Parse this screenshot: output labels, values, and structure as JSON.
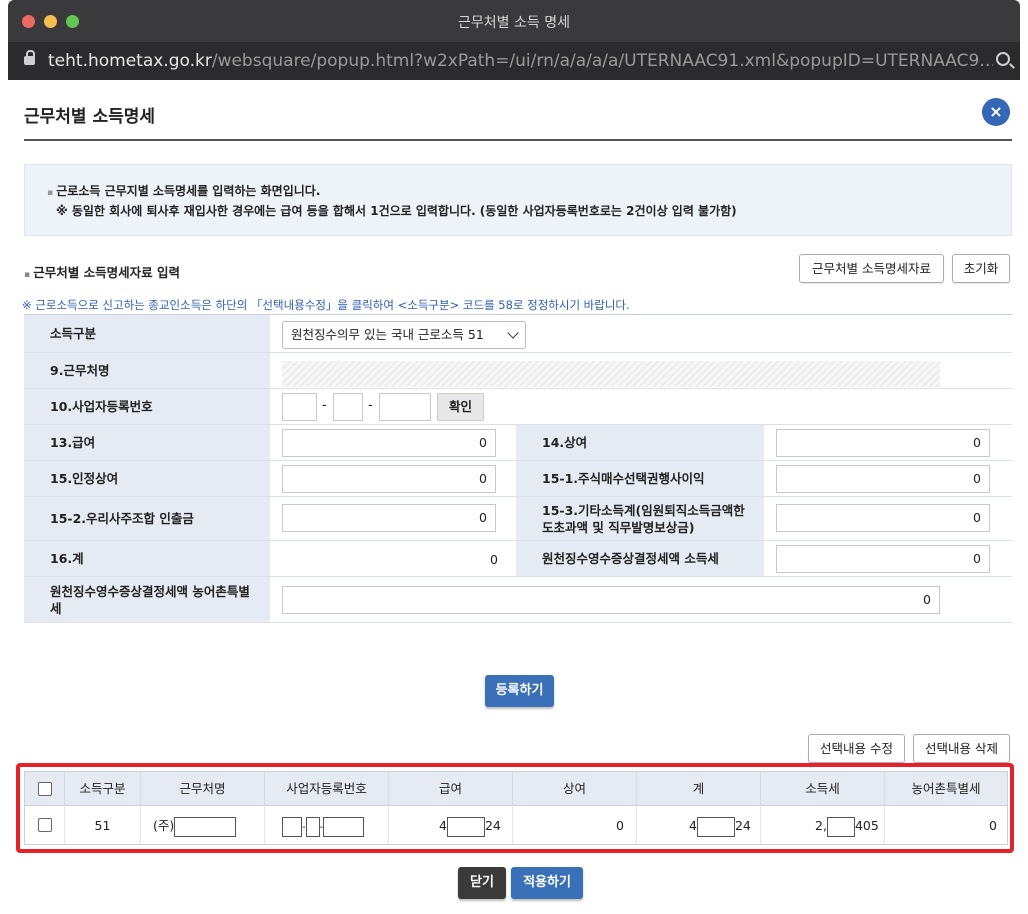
{
  "window": {
    "title": "근무처별 소득 명세"
  },
  "urlbar": {
    "domain": "teht.hometax.go.kr",
    "path": "/websquare/popup.html?w2xPath=/ui/rn/a/a/a/a/UTERNAAC91.xml&popupID=UTERNAAC9…"
  },
  "header": {
    "title": "근무처별 소득명세",
    "close_icon": "×"
  },
  "info": {
    "line1": "근로소득 근무지별 소득명세를 입력하는 화면입니다.",
    "line2": "※ 동일한 회사에 퇴사후 재입사한 경우에는 급여 등을 합해서 1건으로 입력합니다. (동일한 사업자등록번호로는 2건이상 입력 불가함)"
  },
  "section": {
    "title": "근무처별 소득명세자료 입력",
    "data_button": "근무처별 소득명세자료",
    "reset_button": "초기화",
    "notice": "※ 근로소득으로 신고하는 종교인소득은 하단의 「선택내용수정」을 클릭하여 <소득구분> 코드를 58로 정정하시기 바랍니다."
  },
  "form": {
    "income_type_label": "소득구분",
    "income_type_value": "원천징수의무 있는 국내 근로소득 51",
    "workplace_label": "9.근무처명",
    "bizno_label": "10.사업자등록번호",
    "bizno_sep": "-",
    "confirm_button": "확인",
    "salary_label": "13.급여",
    "salary_value": "0",
    "bonus_label": "14.상여",
    "bonus_value": "0",
    "deemed_bonus_label": "15.인정상여",
    "deemed_bonus_value": "0",
    "stock_option_label": "15-1.주식매수선택권행사이익",
    "stock_option_value": "0",
    "esop_label": "15-2.우리사주조합 인출금",
    "esop_value": "0",
    "other_income_label_1": "15-3.기타소득계(임원퇴직소득금액한",
    "other_income_label_2": "도초과액 및 직무발명보상금)",
    "other_income_value": "0",
    "total_label": "16.계",
    "total_value": "0",
    "income_tax_label": "원천징수영수증상결정세액 소득세",
    "income_tax_value": "0",
    "rural_tax_label_1": "원천징수영수증상결정세액 농어촌특별",
    "rural_tax_label_2": "세",
    "rural_tax_value": "0"
  },
  "actions": {
    "register": "등록하기",
    "edit_selected": "선택내용 수정",
    "delete_selected": "선택내용 삭제",
    "close": "닫기",
    "apply": "적용하기"
  },
  "grid": {
    "headers": [
      "소득구분",
      "근무처명",
      "사업자등록번호",
      "급여",
      "상여",
      "계",
      "소득세",
      "농어촌특별세"
    ],
    "row": {
      "type": "51",
      "name_prefix": "(주)",
      "salary_a": "4",
      "salary_b": "24",
      "bonus": "0",
      "total_a": "4",
      "total_b": "24",
      "tax_a": "2,",
      "tax_b": "405",
      "rural": "0"
    }
  },
  "colors": {
    "accent": "#3a70b8",
    "highlight": "#e8202a",
    "label_bg": "#e6eaf3"
  }
}
